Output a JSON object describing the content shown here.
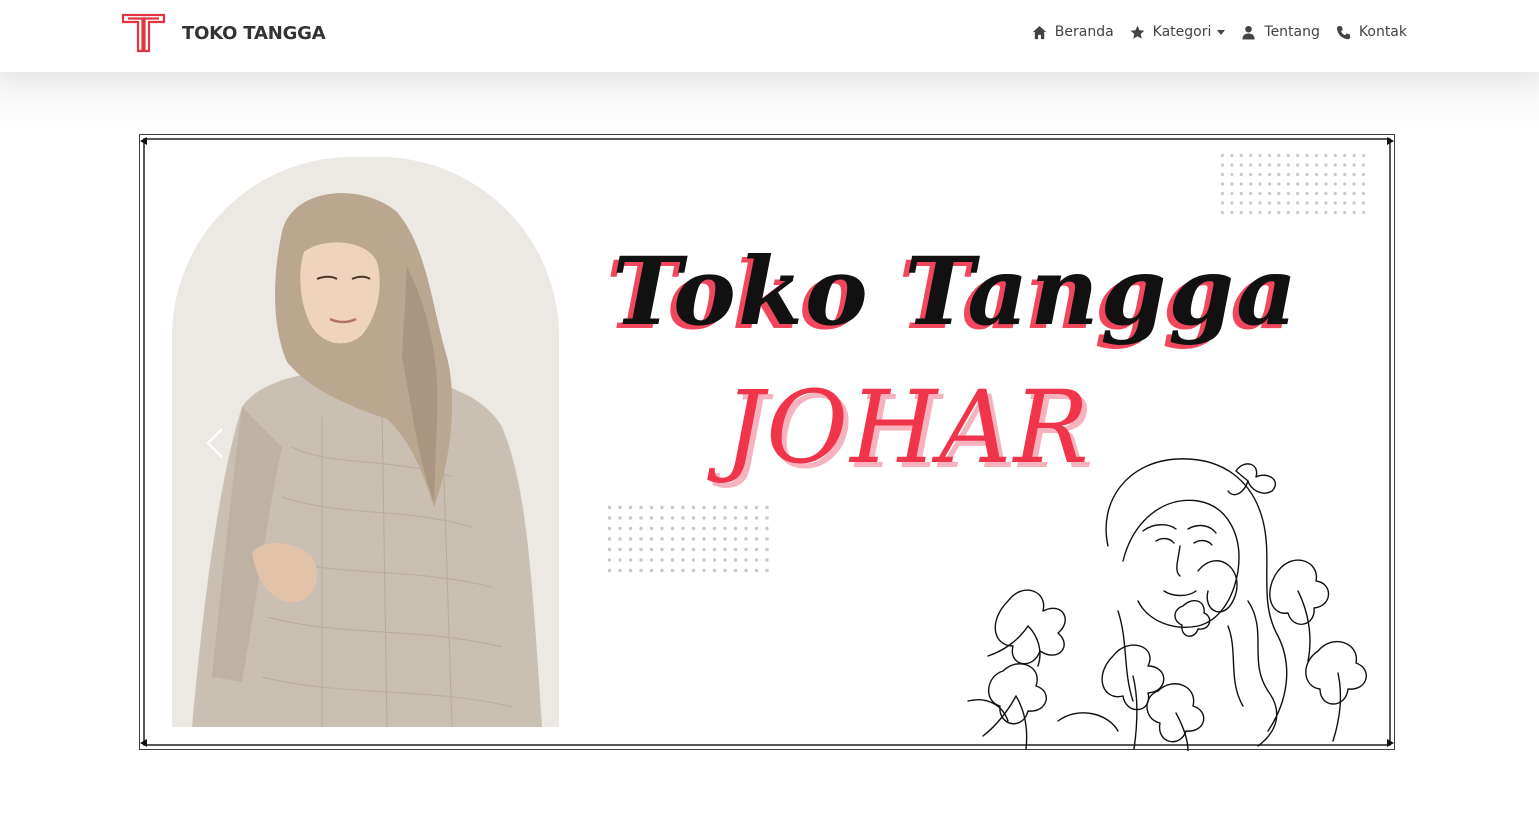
{
  "brand": {
    "name": "TOKO TANGGA",
    "logo_icon": "tt-logo-icon",
    "accent": "#e4343f"
  },
  "nav": {
    "items": [
      {
        "label": "Beranda",
        "icon": "home-icon"
      },
      {
        "label": "Kategori",
        "icon": "star-icon",
        "dropdown": true
      },
      {
        "label": "Tentang",
        "icon": "user-icon"
      },
      {
        "label": "Kontak",
        "icon": "phone-icon"
      }
    ]
  },
  "hero": {
    "title_line1": "Toko Tangga",
    "title_line2": "JOHAR",
    "title_color": "#111111",
    "accent_color": "#f0344a",
    "prev_control_icon": "chevron-left-icon"
  }
}
